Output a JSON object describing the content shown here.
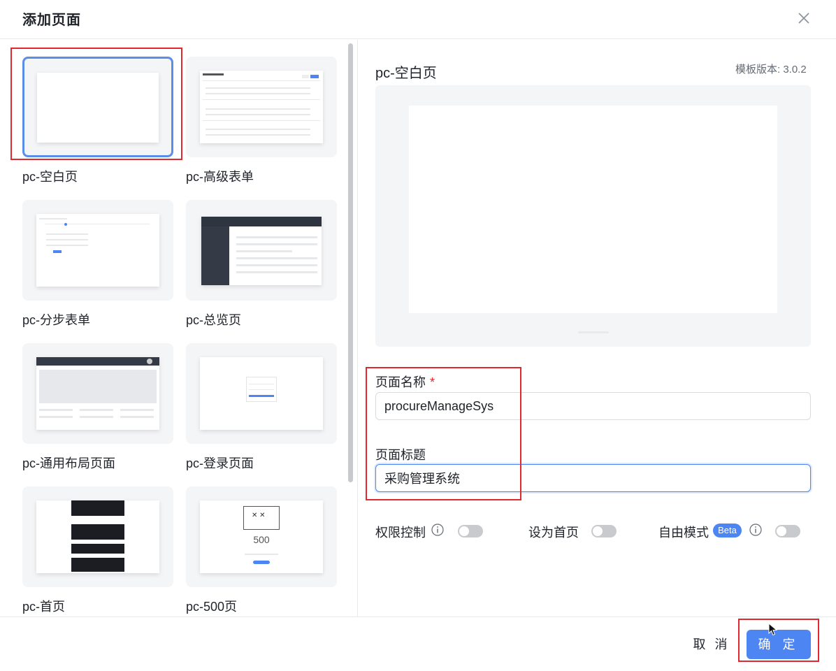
{
  "dialog": {
    "title": "添加页面"
  },
  "templates": [
    {
      "label": "pc-空白页",
      "selected": true
    },
    {
      "label": "pc-高级表单",
      "selected": false
    },
    {
      "label": "pc-分步表单",
      "selected": false
    },
    {
      "label": "pc-总览页",
      "selected": false
    },
    {
      "label": "pc-通用布局页面",
      "selected": false
    },
    {
      "label": "pc-登录页面",
      "selected": false
    },
    {
      "label": "pc-首页",
      "selected": false
    },
    {
      "label": "pc-500页",
      "selected": false
    }
  ],
  "thumb_text": {
    "error_code": "500"
  },
  "preview": {
    "title": "pc-空白页",
    "version": "模板版本: 3.0.2"
  },
  "form": {
    "name_label": "页面名称",
    "name_required": "*",
    "name_value": "procureManageSys",
    "title_label": "页面标题",
    "title_value": "采购管理系统"
  },
  "options": {
    "permission_label": "权限控制",
    "homepage_label": "设为首页",
    "free_mode_label": "自由模式",
    "beta_badge": "Beta",
    "permission_on": false,
    "homepage_on": false,
    "free_mode_on": false
  },
  "footer": {
    "cancel_label": "取 消",
    "ok_label": "确 定"
  },
  "colors": {
    "primary": "#4d86f2",
    "highlight_box": "#e0282e",
    "switch_off": "#c9cacd"
  }
}
